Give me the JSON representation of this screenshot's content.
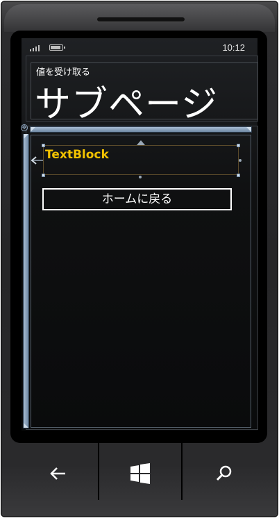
{
  "status_bar": {
    "time": "10:12",
    "icons": [
      "signal-icon",
      "battery-icon"
    ]
  },
  "header": {
    "app_title": "値を受け取る",
    "page_title": "サブページ"
  },
  "content": {
    "textblock_text": "TextBlock",
    "home_button_label": "ホームに戻る"
  },
  "hardware_buttons": [
    "back-arrow-icon",
    "windows-logo-icon",
    "search-icon"
  ],
  "colors": {
    "accent_text": "#f2c200",
    "designer_rail": "#8ea5be",
    "screen_background": "#0a0b0c"
  }
}
